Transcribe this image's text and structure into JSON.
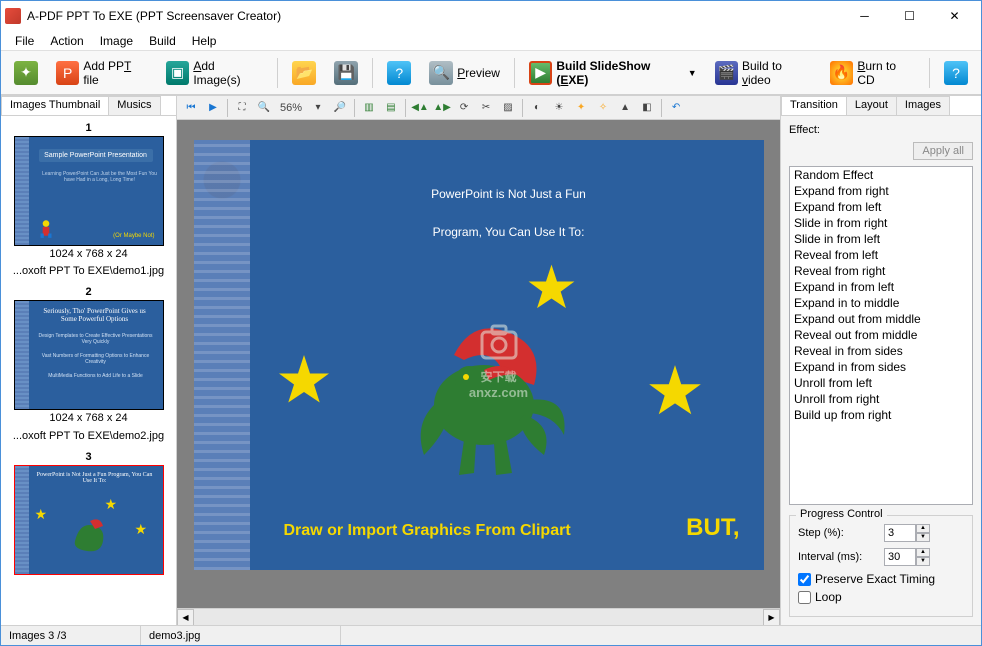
{
  "title": "A-PDF PPT To EXE (PPT Screensaver Creator)",
  "menu": [
    "File",
    "Action",
    "Image",
    "Build",
    "Help"
  ],
  "toolbar": {
    "add_ppt": "Add PPT file",
    "add_imgs": "Add Image(s)",
    "preview": "Preview",
    "build_exe": "Build SlideShow (EXE)",
    "build_video": "Build to video",
    "burn_cd": "Burn to CD"
  },
  "left_tabs": {
    "thumbs": "Images Thumbnail",
    "musics": "Musics"
  },
  "thumbs": [
    {
      "num": "1",
      "dim": "1024 x 768 x 24",
      "path": "...oxoft PPT To EXE\\demo1.jpg",
      "title": "Sample PowerPoint Presentation",
      "body": "Learning PowerPoint Can Just be the Most Fun You have Had in a Long, Long Time!",
      "footer": "(Or Maybe Not)"
    },
    {
      "num": "2",
      "dim": "1024 x 768 x 24",
      "path": "...oxoft PPT To EXE\\demo2.jpg",
      "title": "Seriously, Tho' PowerPoint Gives us Some Powerful Options",
      "b1": "Design Templates to Create Effective Presentations Very Quickly",
      "b2": "Vast Numbers of Formatting Options to Enhance Creativity",
      "b3": "MultiMedia Functions to Add Life to a Slide"
    },
    {
      "num": "3",
      "title": "PowerPoint is Not Just a Fun Program, You Can Use It To:"
    }
  ],
  "zoom": "56%",
  "slide": {
    "title_l1": "PowerPoint is Not Just a Fun",
    "title_l2": "Program, You Can Use It To:",
    "caption": "Draw or Import Graphics From Clipart",
    "but": "BUT,"
  },
  "watermark": {
    "l1": "安下载",
    "l2": "anxz.com"
  },
  "right_tabs": [
    "Transition",
    "Layout",
    "Images"
  ],
  "effect_label": "Effect:",
  "apply_all": "Apply all",
  "effects": [
    "Random Effect",
    "Expand from right",
    "Expand from left",
    "Slide in from right",
    "Slide in from left",
    "Reveal from left",
    "Reveal from right",
    "Expand in from left",
    "Expand in to middle",
    "Expand out from middle",
    "Reveal out from middle",
    "Reveal in from sides",
    "Expand in from sides",
    "Unroll from left",
    "Unroll from right",
    "Build up from right"
  ],
  "progress": {
    "legend": "Progress Control",
    "step_label": "Step (%):",
    "step_val": "3",
    "interval_label": "Interval (ms):",
    "interval_val": "30",
    "preserve": "Preserve Exact Timing",
    "loop": "Loop"
  },
  "status": {
    "left": "Images 3 /3",
    "file": "demo3.jpg"
  }
}
